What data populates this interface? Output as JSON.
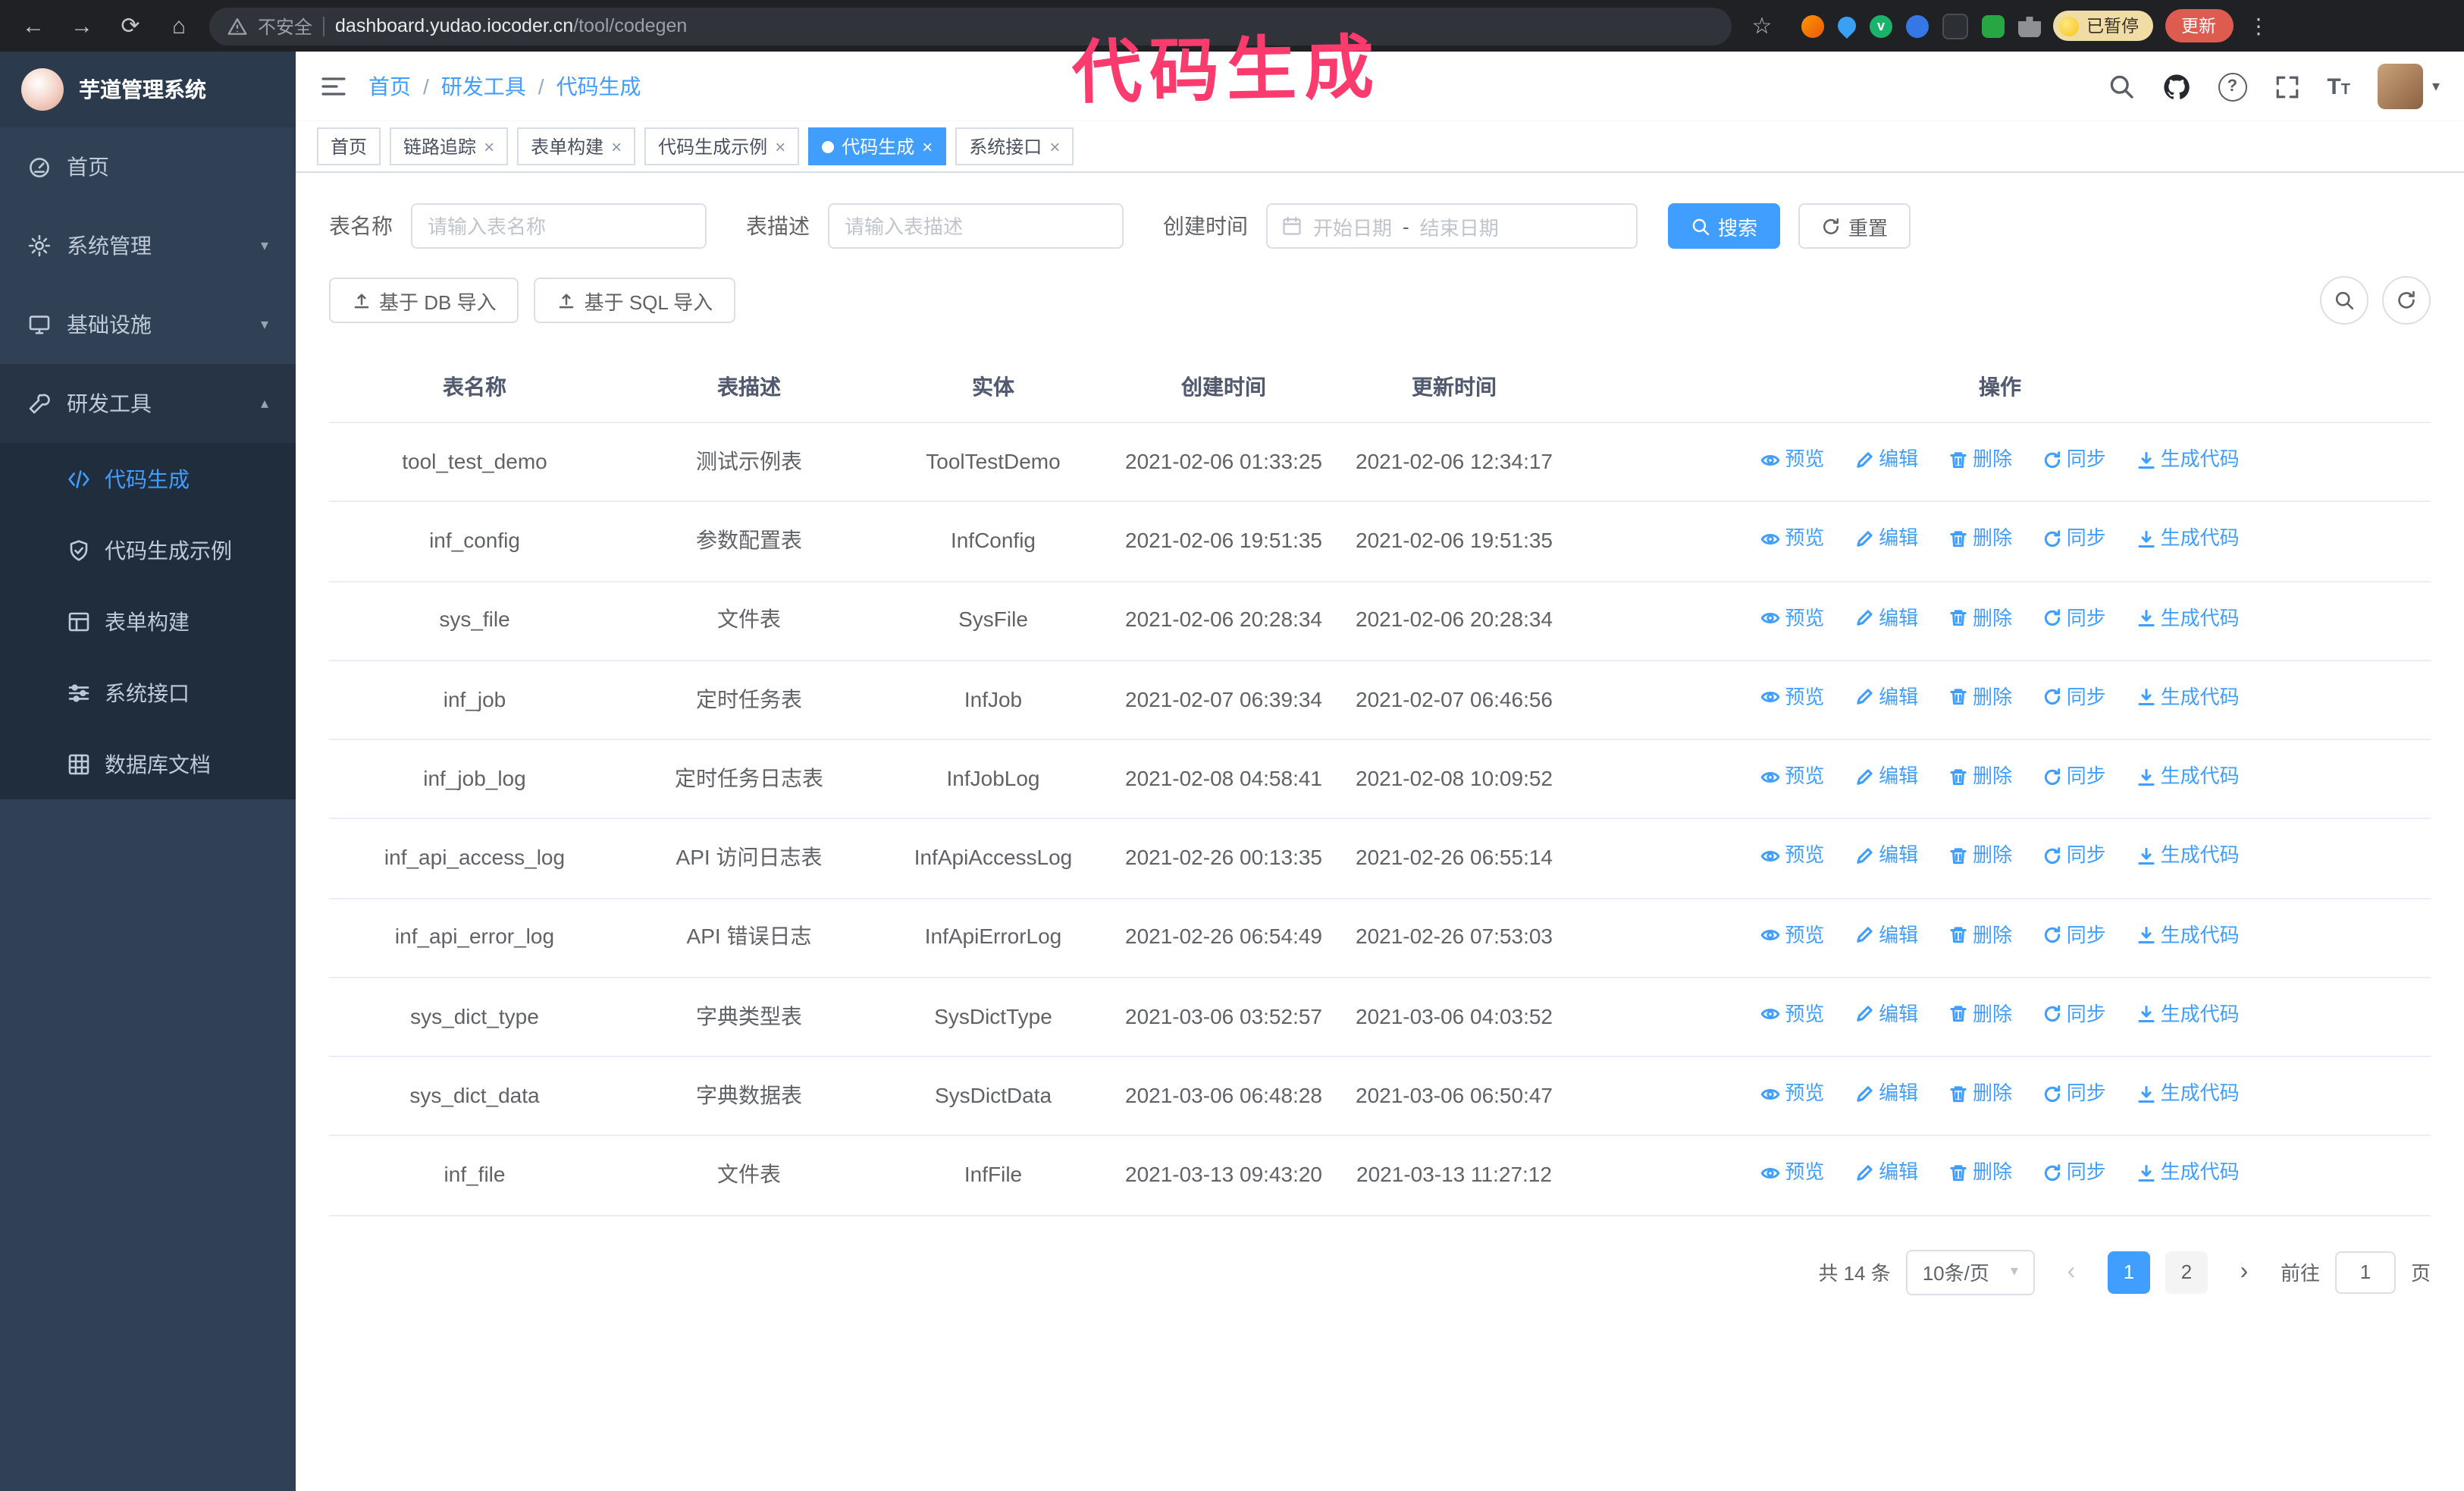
{
  "browser": {
    "security_label": "不安全",
    "url_domain": "dashboard.yudao.iocoder.cn",
    "url_path": "/tool/codegen",
    "paused_badge": "已暂停",
    "update_button": "更新"
  },
  "annotation": {
    "text": "代码生成",
    "color": "#fb3b6e"
  },
  "icons": {
    "back": "←",
    "forward": "→",
    "reload": "⟳",
    "home": "⌂",
    "star": "☆",
    "menu_kebab": "⋮",
    "close": "×",
    "caret_down": "▾",
    "caret_up": "▴",
    "prev": "‹",
    "next": "›",
    "question": "?",
    "font_large": "T",
    "font_small": "T",
    "ext_v": "v"
  },
  "sidebar": {
    "logo_title": "芋道管理系统",
    "items": [
      {
        "label": "首页"
      },
      {
        "label": "系统管理"
      },
      {
        "label": "基础设施"
      },
      {
        "label": "研发工具"
      }
    ],
    "subitems": [
      {
        "label": "代码生成",
        "active": true
      },
      {
        "label": "代码生成示例"
      },
      {
        "label": "表单构建"
      },
      {
        "label": "系统接口"
      },
      {
        "label": "数据库文档"
      }
    ]
  },
  "breadcrumb": {
    "items": [
      "首页",
      "研发工具",
      "代码生成"
    ],
    "separator": "/"
  },
  "tags": [
    {
      "label": "首页",
      "closable": false,
      "active": false
    },
    {
      "label": "链路追踪",
      "closable": true,
      "active": false
    },
    {
      "label": "表单构建",
      "closable": true,
      "active": false
    },
    {
      "label": "代码生成示例",
      "closable": true,
      "active": false
    },
    {
      "label": "代码生成",
      "closable": true,
      "active": true
    },
    {
      "label": "系统接口",
      "closable": true,
      "active": false
    }
  ],
  "filters": {
    "table_name_label": "表名称",
    "table_name_placeholder": "请输入表名称",
    "table_desc_label": "表描述",
    "table_desc_placeholder": "请输入表描述",
    "create_time_label": "创建时间",
    "date_start_placeholder": "开始日期",
    "date_range_separator": "-",
    "date_end_placeholder": "结束日期",
    "search_button": "搜索",
    "reset_button": "重置"
  },
  "toolbar": {
    "import_db": "基于 DB 导入",
    "import_sql": "基于 SQL 导入"
  },
  "table": {
    "columns": [
      "表名称",
      "表描述",
      "实体",
      "创建时间",
      "更新时间",
      "操作"
    ],
    "actions": [
      "预览",
      "编辑",
      "删除",
      "同步",
      "生成代码"
    ],
    "rows": [
      {
        "name": "tool_test_demo",
        "desc": "测试示例表",
        "entity": "ToolTestDemo",
        "created": "2021-02-06 01:33:25",
        "updated": "2021-02-06 12:34:17"
      },
      {
        "name": "inf_config",
        "desc": "参数配置表",
        "entity": "InfConfig",
        "created": "2021-02-06 19:51:35",
        "updated": "2021-02-06 19:51:35"
      },
      {
        "name": "sys_file",
        "desc": "文件表",
        "entity": "SysFile",
        "created": "2021-02-06 20:28:34",
        "updated": "2021-02-06 20:28:34"
      },
      {
        "name": "inf_job",
        "desc": "定时任务表",
        "entity": "InfJob",
        "created": "2021-02-07 06:39:34",
        "updated": "2021-02-07 06:46:56"
      },
      {
        "name": "inf_job_log",
        "desc": "定时任务日志表",
        "entity": "InfJobLog",
        "created": "2021-02-08 04:58:41",
        "updated": "2021-02-08 10:09:52"
      },
      {
        "name": "inf_api_access_log",
        "desc": "API 访问日志表",
        "entity": "InfApiAccessLog",
        "created": "2021-02-26 00:13:35",
        "updated": "2021-02-26 06:55:14"
      },
      {
        "name": "inf_api_error_log",
        "desc": "API 错误日志",
        "entity": "InfApiErrorLog",
        "created": "2021-02-26 06:54:49",
        "updated": "2021-02-26 07:53:03"
      },
      {
        "name": "sys_dict_type",
        "desc": "字典类型表",
        "entity": "SysDictType",
        "created": "2021-03-06 03:52:57",
        "updated": "2021-03-06 04:03:52"
      },
      {
        "name": "sys_dict_data",
        "desc": "字典数据表",
        "entity": "SysDictData",
        "created": "2021-03-06 06:48:28",
        "updated": "2021-03-06 06:50:47"
      },
      {
        "name": "inf_file",
        "desc": "文件表",
        "entity": "InfFile",
        "created": "2021-03-13 09:43:20",
        "updated": "2021-03-13 11:27:12"
      }
    ]
  },
  "pagination": {
    "total": "共 14 条",
    "page_size": "10条/页",
    "pages": [
      "1",
      "2"
    ],
    "active_page": "1",
    "goto_label": "前往",
    "goto_value": "1",
    "goto_suffix": "页"
  },
  "colors": {
    "primary": "#409eff",
    "sidebar_bg": "#304156",
    "submenu_bg": "#1f2d3d",
    "annotation": "#fb3b6e",
    "update_button": "#dd5b4f",
    "paused_badge_bg": "#f0dda6"
  }
}
